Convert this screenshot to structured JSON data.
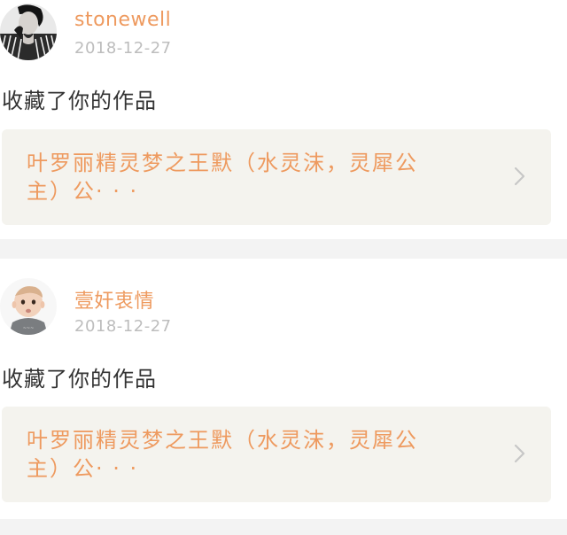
{
  "feed": {
    "items": [
      {
        "username": "stonewell",
        "date": "2018-12-27",
        "action": "收藏了你的作品",
        "work_title": "叶罗丽精灵梦之王默（水灵沫，灵犀公主）公· · ·",
        "avatar_icon": "avatar-person-striped-shirt-icon"
      },
      {
        "username": "壹奸衷情",
        "date": "2018-12-27",
        "action": "收藏了你的作品",
        "work_title": "叶罗丽精灵梦之王默（水灵沫，灵犀公主）公· · ·",
        "avatar_icon": "avatar-baby-icon"
      }
    ]
  },
  "colors": {
    "accent": "#ee9a5f",
    "muted": "#bdbdbd",
    "text": "#333333",
    "box_bg": "#f4f3ee",
    "divider": "#f3f3f3"
  }
}
